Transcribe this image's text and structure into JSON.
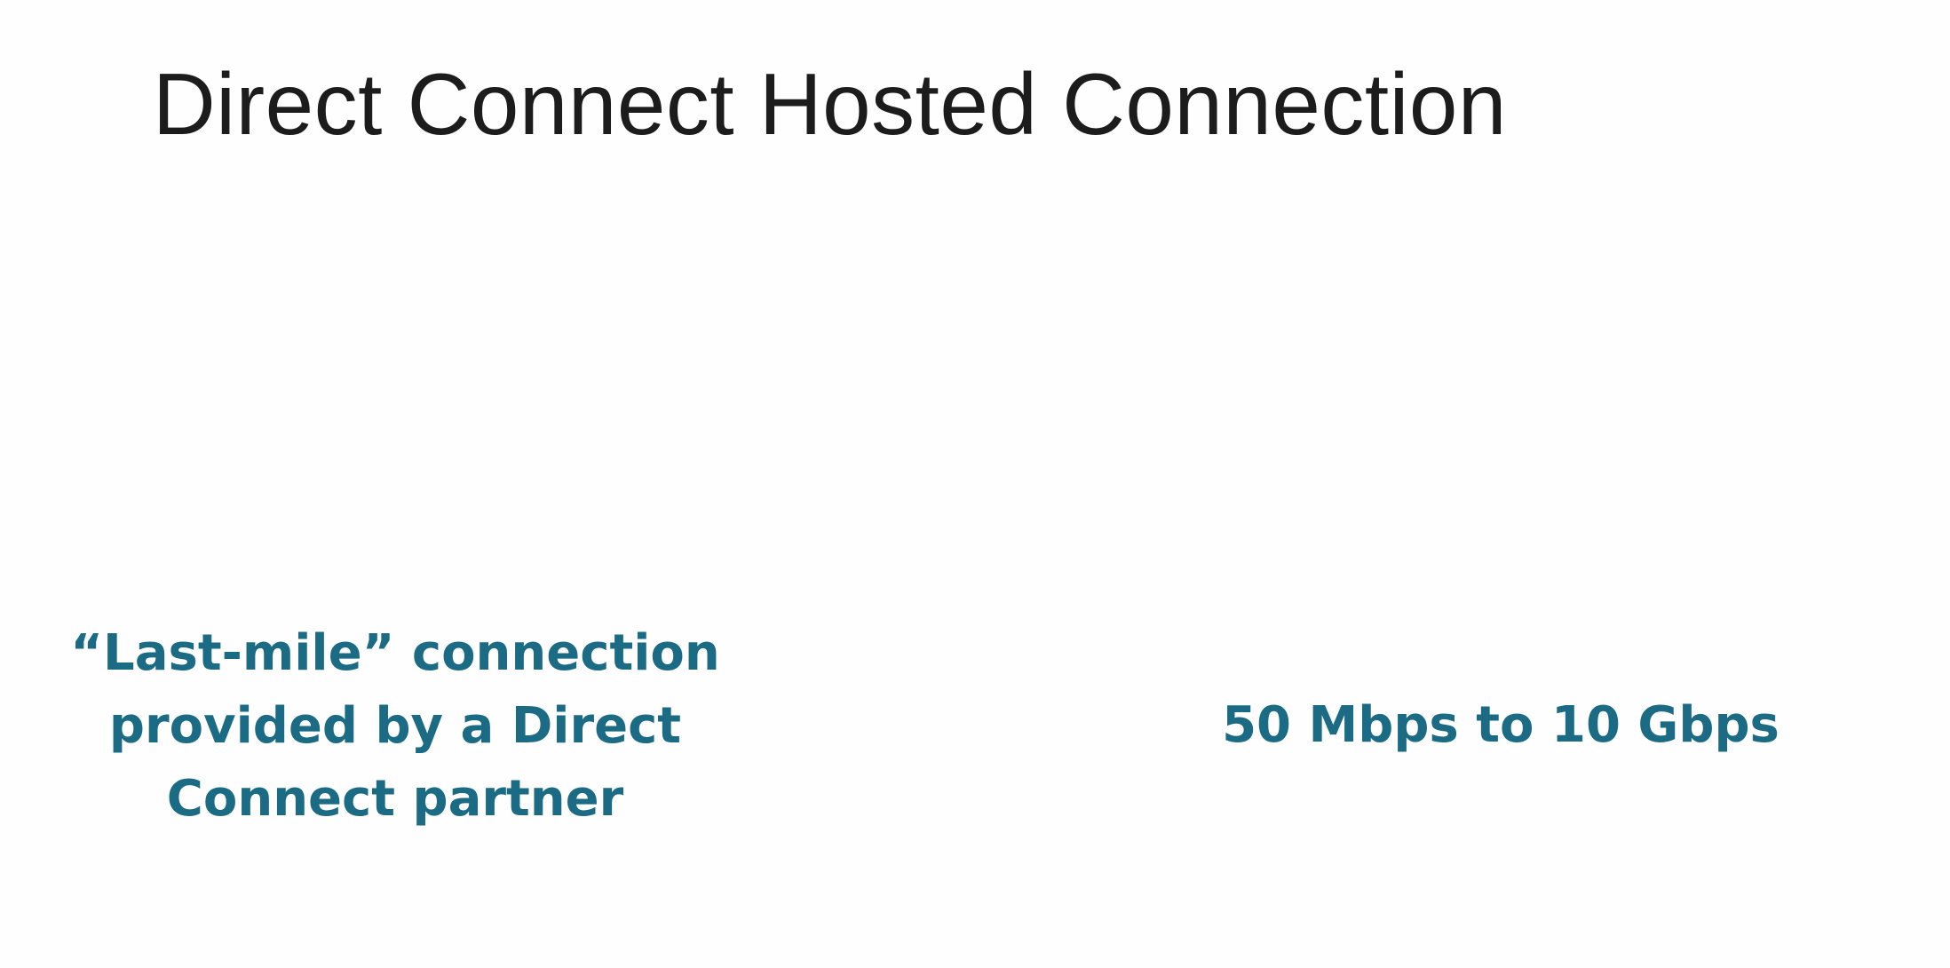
{
  "slide": {
    "title": "Direct Connect Hosted Connection",
    "points": [
      "“Last-mile” connection provided by a Direct Connect partner",
      "50 Mbps to 10 Gbps"
    ]
  }
}
